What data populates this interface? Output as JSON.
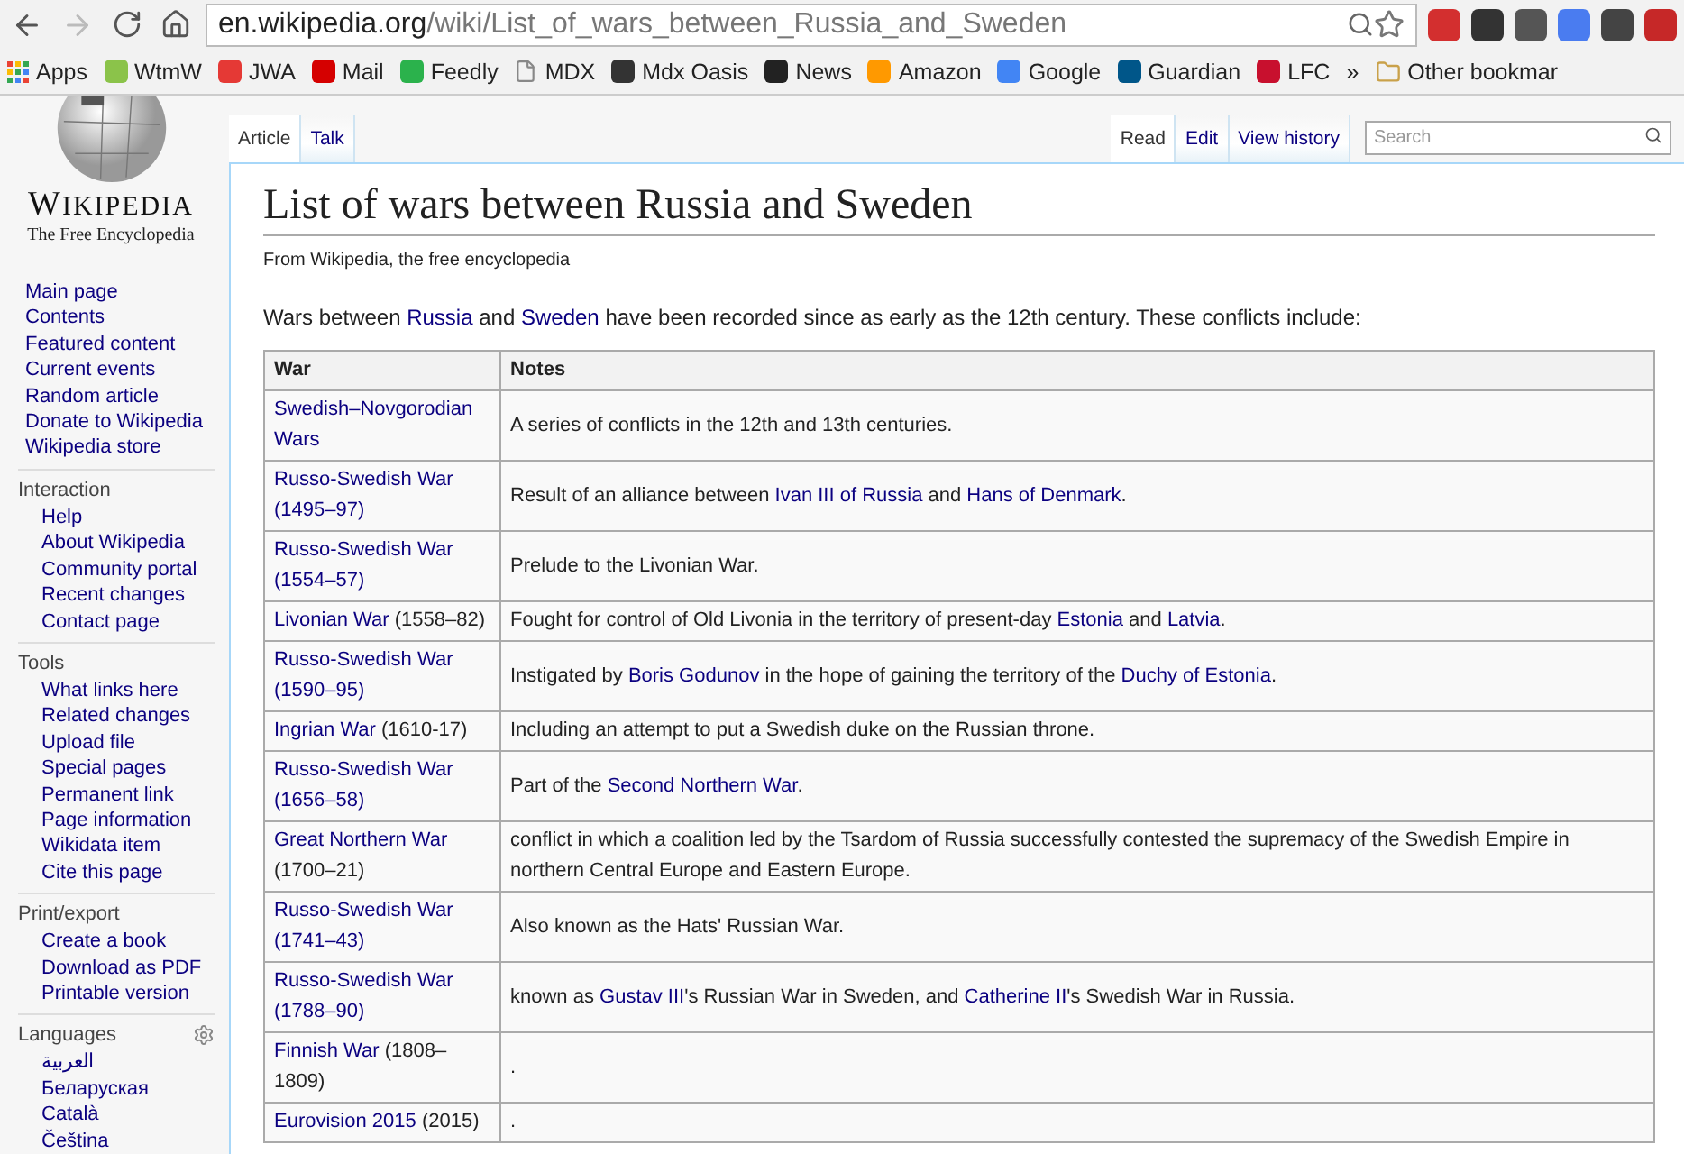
{
  "browser": {
    "url_host": "en.wikipedia.org",
    "url_path": "/wiki/List_of_wars_between_Russia_and_Sweden",
    "bookmarks": [
      {
        "kind": "apps",
        "label": "Apps"
      },
      {
        "kind": "site",
        "label": "WtmW",
        "color": "#8bc34a"
      },
      {
        "kind": "site",
        "label": "JWA",
        "color": "#e53935"
      },
      {
        "kind": "site",
        "label": "Mail",
        "color": "#d50000"
      },
      {
        "kind": "site",
        "label": "Feedly",
        "color": "#2bb24c"
      },
      {
        "kind": "page",
        "label": "MDX"
      },
      {
        "kind": "site",
        "label": "Mdx Oasis",
        "color": "#333333"
      },
      {
        "kind": "site",
        "label": "News",
        "color": "#222222"
      },
      {
        "kind": "site",
        "label": "Amazon",
        "color": "#ff9900"
      },
      {
        "kind": "site",
        "label": "Google",
        "color": "#4285f4"
      },
      {
        "kind": "site",
        "label": "Guardian",
        "color": "#005689"
      },
      {
        "kind": "site",
        "label": "LFC",
        "color": "#c8102e"
      },
      {
        "kind": "overflow",
        "label": "»"
      },
      {
        "kind": "folder",
        "label": "Other bookmar"
      }
    ]
  },
  "sidebar": {
    "wordmark": "WIKIPEDIA",
    "tagline": "The Free Encyclopedia",
    "main_items": [
      "Main page",
      "Contents",
      "Featured content",
      "Current events",
      "Random article",
      "Donate to Wikipedia",
      "Wikipedia store"
    ],
    "sections": [
      {
        "heading": "Interaction",
        "items": [
          "Help",
          "About Wikipedia",
          "Community portal",
          "Recent changes",
          "Contact page"
        ]
      },
      {
        "heading": "Tools",
        "items": [
          "What links here",
          "Related changes",
          "Upload file",
          "Special pages",
          "Permanent link",
          "Page information",
          "Wikidata item",
          "Cite this page"
        ]
      },
      {
        "heading": "Print/export",
        "items": [
          "Create a book",
          "Download as PDF",
          "Printable version"
        ]
      },
      {
        "heading": "Languages",
        "settings": true,
        "items": [
          "العربية",
          "Беларуская",
          "Català",
          "Čeština"
        ]
      }
    ]
  },
  "tabs_left": [
    {
      "label": "Article",
      "selected": true
    },
    {
      "label": "Talk",
      "selected": false
    }
  ],
  "tabs_right": [
    {
      "label": "Read",
      "selected": true
    },
    {
      "label": "Edit",
      "selected": false
    },
    {
      "label": "View history",
      "selected": false
    }
  ],
  "search": {
    "placeholder": "Search"
  },
  "article": {
    "title": "List of wars between Russia and Sweden",
    "tagline": "From Wikipedia, the free encyclopedia",
    "intro": [
      {
        "text": "Wars between "
      },
      {
        "text": "Russia",
        "link": true
      },
      {
        "text": " and "
      },
      {
        "text": "Sweden",
        "link": true
      },
      {
        "text": " have been recorded since as early as the 12th century. These conflicts include:"
      }
    ],
    "table": {
      "columns": [
        "War",
        "Notes"
      ],
      "rows": [
        {
          "war": [
            {
              "text": "Swedish–Novgorodian Wars",
              "link": true
            }
          ],
          "notes": [
            {
              "text": "A series of conflicts in the 12th and 13th centuries."
            }
          ]
        },
        {
          "war": [
            {
              "text": "Russo-Swedish War (1495–97)",
              "link": true
            }
          ],
          "notes": [
            {
              "text": "Result of an alliance between "
            },
            {
              "text": "Ivan III of Russia",
              "link": true
            },
            {
              "text": " and "
            },
            {
              "text": "Hans of Denmark",
              "link": true
            },
            {
              "text": "."
            }
          ]
        },
        {
          "war": [
            {
              "text": "Russo-Swedish War (1554–57)",
              "link": true
            }
          ],
          "notes": [
            {
              "text": "Prelude to the Livonian War."
            }
          ]
        },
        {
          "war": [
            {
              "text": "Livonian War",
              "link": true
            },
            {
              "text": " (1558–82)"
            }
          ],
          "notes": [
            {
              "text": "Fought for control of Old Livonia in the territory of present-day "
            },
            {
              "text": "Estonia",
              "link": true
            },
            {
              "text": " and "
            },
            {
              "text": "Latvia",
              "link": true
            },
            {
              "text": "."
            }
          ]
        },
        {
          "war": [
            {
              "text": "Russo-Swedish War (1590–95)",
              "link": true
            }
          ],
          "notes": [
            {
              "text": "Instigated by "
            },
            {
              "text": "Boris Godunov",
              "link": true
            },
            {
              "text": " in the hope of gaining the territory of the "
            },
            {
              "text": "Duchy of Estonia",
              "link": true
            },
            {
              "text": "."
            }
          ]
        },
        {
          "war": [
            {
              "text": "Ingrian War",
              "link": true
            },
            {
              "text": " (1610-17)"
            }
          ],
          "notes": [
            {
              "text": "Including an attempt to put a Swedish duke on the Russian throne."
            }
          ]
        },
        {
          "war": [
            {
              "text": "Russo-Swedish War (1656–58)",
              "link": true
            }
          ],
          "notes": [
            {
              "text": "Part of the "
            },
            {
              "text": "Second Northern War",
              "link": true
            },
            {
              "text": "."
            }
          ]
        },
        {
          "war": [
            {
              "text": "Great Northern War",
              "link": true
            },
            {
              "text": " (1700–21)"
            }
          ],
          "notes": [
            {
              "text": "conflict in which a coalition led by the Tsardom of Russia successfully contested the supremacy of the Swedish Empire in northern Central Europe and Eastern Europe."
            }
          ]
        },
        {
          "war": [
            {
              "text": "Russo-Swedish War (1741–43)",
              "link": true
            }
          ],
          "notes": [
            {
              "text": "Also known as the Hats' Russian War."
            }
          ]
        },
        {
          "war": [
            {
              "text": "Russo-Swedish War (1788–90)",
              "link": true
            }
          ],
          "notes": [
            {
              "text": "known as "
            },
            {
              "text": "Gustav III",
              "link": true
            },
            {
              "text": "'s Russian War in Sweden, and "
            },
            {
              "text": "Catherine II",
              "link": true
            },
            {
              "text": "'s Swedish War in Russia."
            }
          ]
        },
        {
          "war": [
            {
              "text": "Finnish War",
              "link": true
            },
            {
              "text": " (1808–1809)"
            }
          ],
          "notes": [
            {
              "text": "."
            }
          ]
        },
        {
          "war": [
            {
              "text": "Eurovision 2015",
              "link": true
            },
            {
              "text": " (2015)"
            }
          ],
          "notes": [
            {
              "text": "."
            }
          ]
        }
      ]
    }
  }
}
